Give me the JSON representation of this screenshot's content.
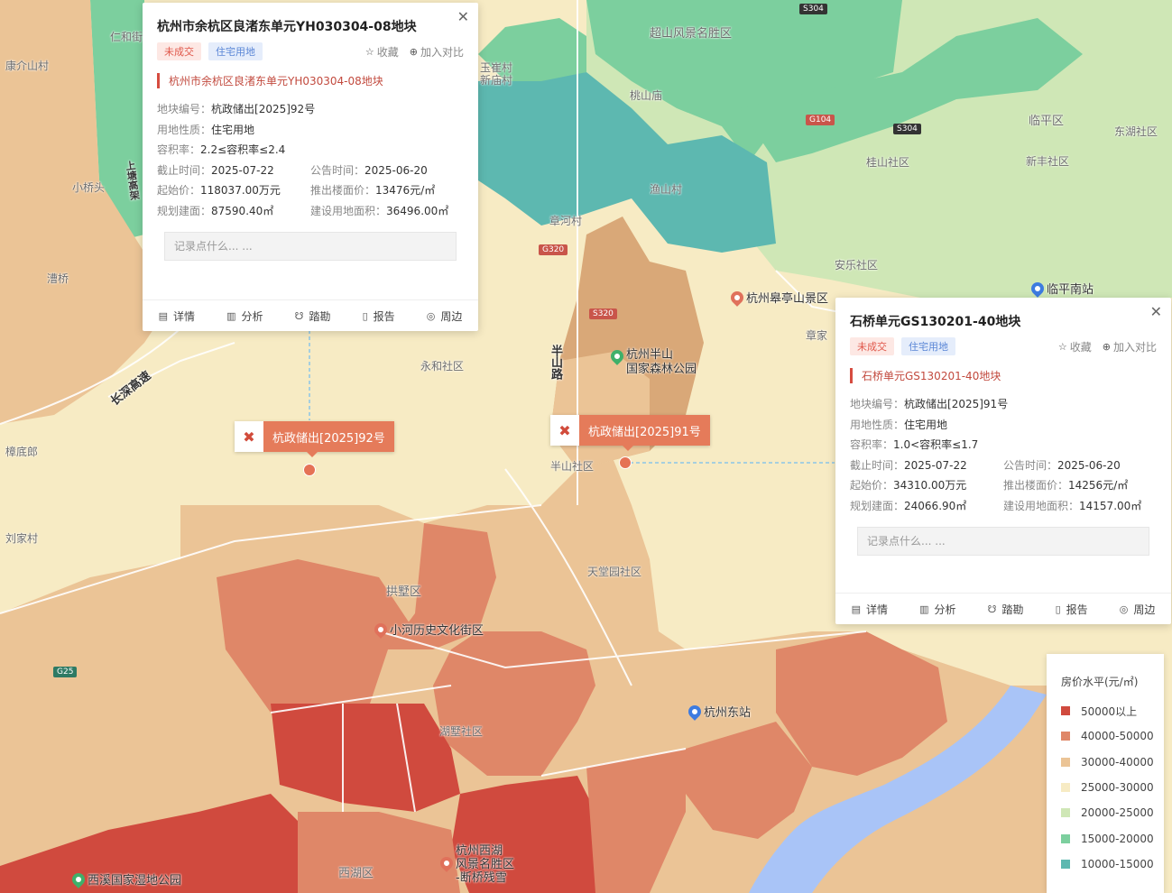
{
  "colors": {
    "tier_50000_plus": "#d04a3e",
    "tier_40000_50000": "#df8768",
    "tier_30000_40000": "#ebc496",
    "tier_25000_30000": "#f7ebc4",
    "tier_20000_25000": "#cfe7b6",
    "tier_15000_20000": "#7ccf9e",
    "tier_10000_15000": "#5db8b0",
    "water": "#a9c4f7",
    "accent_red": "#d64c40",
    "marker_orange": "#e57b5a"
  },
  "map_labels": {
    "chaoshan": "超山风景名胜区",
    "renhe": "仁和街",
    "kangjiezhan": "康介山村",
    "yuhuacun": "玉崔村",
    "xinmiao": "新庙村",
    "taoshan": "桃山庙",
    "linping_qu": "临平区",
    "donghu": "东湖社区",
    "guishan": "桂山社区",
    "xinfeng": "新丰社区",
    "xiaoqiaotou": "小桥头",
    "yushanccun": "渔山村",
    "zhangjiacun": "章河村",
    "anle": "安乐社区",
    "qiaoqiao": "漕桥",
    "yonghe": "永和社区",
    "zhangjia": "章家",
    "chudilang": "樟底郎",
    "liujiacun": "刘家村",
    "banshan_shequ": "半山社区",
    "tiantangyuan": "天堂园社区",
    "gongshu": "拱墅区",
    "hupan": "湖墅社区",
    "xihu": "西湖区",
    "xiaoshi": "小石"
  },
  "road_labels": {
    "changshen": "长深高速",
    "banshan_road": "半山路",
    "shangtang": "上塘高架"
  },
  "route_shields": {
    "s304_top": "S304",
    "s304_mid": "S304",
    "g104": "G104",
    "s320": "S320",
    "g320": "G320",
    "g25": "G25"
  },
  "pois": {
    "gaoting": "杭州皋亭山景区",
    "linping_south": "临平南站",
    "banshan_park_1": "杭州半山",
    "banshan_park_2": "国家森林公园",
    "xiaohe": "小河历史文化街区",
    "hangzhou_east": "杭州东站",
    "xixi": "西溪国家湿地公园",
    "westlake_1": "杭州西湖",
    "westlake_2": "风景名胜区",
    "westlake_3": "-断桥残雪"
  },
  "markers": {
    "m92": "杭政储出[2025]92号",
    "m91": "杭政储出[2025]91号"
  },
  "popup1": {
    "title": "杭州市余杭区良渚东单元YH030304-08地块",
    "tag_status": "未成交",
    "tag_use": "住宅用地",
    "collect": "收藏",
    "compare": "加入对比",
    "subtitle": "杭州市余杭区良渚东单元YH030304-08地块",
    "plot_no_label": "地块编号：",
    "plot_no": "杭政储出[2025]92号",
    "land_use_label": "用地性质：",
    "land_use": "住宅用地",
    "far_label": "容积率：",
    "far": "2.2≤容积率≤2.4",
    "deadline_label": "截止时间：",
    "deadline": "2025-07-22",
    "announce_label": "公告时间：",
    "announce": "2025-06-20",
    "start_price_label": "起始价：",
    "start_price": "118037.00万元",
    "floor_price_label": "推出楼面价：",
    "floor_price": "13476元/㎡",
    "planned_area_label": "规划建面：",
    "planned_area": "87590.40㎡",
    "land_area_label": "建设用地面积：",
    "land_area": "36496.00㎡",
    "note_placeholder": "记录点什么... ...",
    "btn_detail": "详情",
    "btn_analysis": "分析",
    "btn_survey": "踏勘",
    "btn_report": "报告",
    "btn_nearby": "周边"
  },
  "popup2": {
    "title": "石桥单元GS130201-40地块",
    "tag_status": "未成交",
    "tag_use": "住宅用地",
    "collect": "收藏",
    "compare": "加入对比",
    "subtitle": "石桥单元GS130201-40地块",
    "plot_no_label": "地块编号：",
    "plot_no": "杭政储出[2025]91号",
    "land_use_label": "用地性质：",
    "land_use": "住宅用地",
    "far_label": "容积率：",
    "far": "1.0<容积率≤1.7",
    "deadline_label": "截止时间：",
    "deadline": "2025-07-22",
    "announce_label": "公告时间：",
    "announce": "2025-06-20",
    "start_price_label": "起始价：",
    "start_price": "34310.00万元",
    "floor_price_label": "推出楼面价：",
    "floor_price": "14256元/㎡",
    "planned_area_label": "规划建面：",
    "planned_area": "24066.90㎡",
    "land_area_label": "建设用地面积：",
    "land_area": "14157.00㎡",
    "note_placeholder": "记录点什么... ...",
    "btn_detail": "详情",
    "btn_analysis": "分析",
    "btn_survey": "踏勘",
    "btn_report": "报告",
    "btn_nearby": "周边"
  },
  "legend": {
    "title": "房价水平(元/㎡)",
    "items": [
      {
        "label": "50000以上",
        "color": "#d04a3e"
      },
      {
        "label": "40000-50000",
        "color": "#df8768"
      },
      {
        "label": "30000-40000",
        "color": "#ebc496"
      },
      {
        "label": "25000-30000",
        "color": "#f7ebc4"
      },
      {
        "label": "20000-25000",
        "color": "#cfe7b6"
      },
      {
        "label": "15000-20000",
        "color": "#7ccf9e"
      },
      {
        "label": "10000-15000",
        "color": "#5db8b0"
      }
    ]
  }
}
